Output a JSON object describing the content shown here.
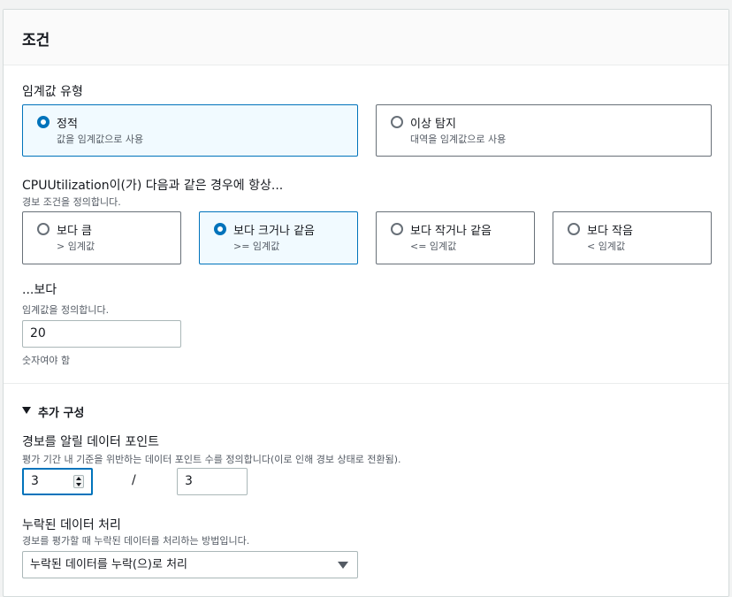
{
  "panel": {
    "title": "조건"
  },
  "threshold_type": {
    "label": "임계값 유형",
    "options": [
      {
        "title": "정적",
        "description": "값을 임계값으로 사용",
        "selected": true
      },
      {
        "title": "이상 탐지",
        "description": "대역을 임계값으로 사용",
        "selected": false
      }
    ]
  },
  "condition": {
    "label": "CPUUtilization이(가) 다음과 같은 경우에 항상...",
    "description": "경보 조건을 정의합니다.",
    "options": [
      {
        "title": "보다 큼",
        "description": "> 임계값",
        "selected": false
      },
      {
        "title": "보다 크거나 같음",
        "description": ">= 임계값",
        "selected": true
      },
      {
        "title": "보다 작거나 같음",
        "description": "<= 임계값",
        "selected": false
      },
      {
        "title": "보다 작음",
        "description": "< 임계값",
        "selected": false
      }
    ]
  },
  "threshold": {
    "label": "...보다",
    "description": "임계값을 정의합니다.",
    "value": "20",
    "hint": "숫자여야 함"
  },
  "additional": {
    "toggle_label": "추가 구성",
    "datapoints": {
      "label": "경보를 알릴 데이터 포인트",
      "description": "평가 기간 내 기준을 위반하는 데이터 포인트 수를 정의합니다(이로 인해 경보 상태로 전환됨).",
      "value": "3",
      "separator": "/",
      "out_of": "3"
    },
    "missing_data": {
      "label": "누락된 데이터 처리",
      "description": "경보를 평가할 때 누락된 데이터를 처리하는 방법입니다.",
      "selected": "누락된 데이터를 누락(으)로 처리"
    }
  }
}
